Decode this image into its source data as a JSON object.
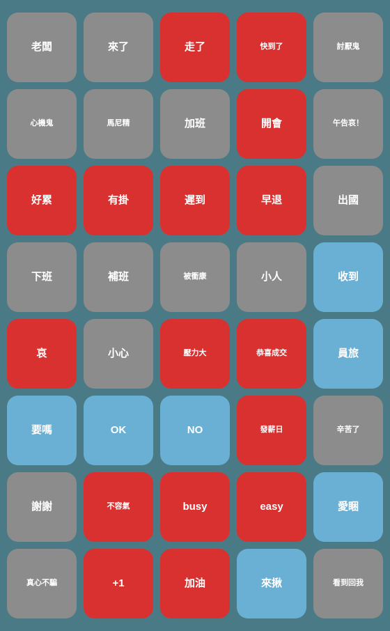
{
  "badges": [
    {
      "label": "老闆",
      "style": "gray",
      "size": "normal"
    },
    {
      "label": "來了",
      "style": "gray",
      "size": "normal"
    },
    {
      "label": "走了",
      "style": "red",
      "size": "normal"
    },
    {
      "label": "快到了",
      "style": "red",
      "size": "small"
    },
    {
      "label": "討厭鬼",
      "style": "gray",
      "size": "small"
    },
    {
      "label": "心機鬼",
      "style": "gray",
      "size": "small"
    },
    {
      "label": "馬尼精",
      "style": "gray",
      "size": "small"
    },
    {
      "label": "加班",
      "style": "gray",
      "size": "normal"
    },
    {
      "label": "開會",
      "style": "red",
      "size": "normal"
    },
    {
      "label": "午告哀！",
      "style": "gray",
      "size": "small"
    },
    {
      "label": "好累",
      "style": "red",
      "size": "normal"
    },
    {
      "label": "有掛",
      "style": "red",
      "size": "normal"
    },
    {
      "label": "遲到",
      "style": "red",
      "size": "normal"
    },
    {
      "label": "早退",
      "style": "red",
      "size": "normal"
    },
    {
      "label": "出國",
      "style": "gray",
      "size": "normal"
    },
    {
      "label": "下班",
      "style": "gray",
      "size": "normal"
    },
    {
      "label": "補班",
      "style": "gray",
      "size": "normal"
    },
    {
      "label": "被衝康",
      "style": "gray",
      "size": "small"
    },
    {
      "label": "小人",
      "style": "gray",
      "size": "normal"
    },
    {
      "label": "收到",
      "style": "blue",
      "size": "normal"
    },
    {
      "label": "哀",
      "style": "red",
      "size": "large"
    },
    {
      "label": "小心",
      "style": "gray",
      "size": "normal"
    },
    {
      "label": "壓力大",
      "style": "red",
      "size": "small"
    },
    {
      "label": "恭喜成交",
      "style": "red",
      "size": "small"
    },
    {
      "label": "員旅",
      "style": "blue",
      "size": "normal"
    },
    {
      "label": "要嗎",
      "style": "blue",
      "size": "normal"
    },
    {
      "label": "OK",
      "style": "blue",
      "size": "normal"
    },
    {
      "label": "NO",
      "style": "blue",
      "size": "normal"
    },
    {
      "label": "發薪日",
      "style": "red",
      "size": "small"
    },
    {
      "label": "辛苦了",
      "style": "gray",
      "size": "small"
    },
    {
      "label": "謝謝",
      "style": "gray",
      "size": "normal"
    },
    {
      "label": "不容氣",
      "style": "red",
      "size": "small"
    },
    {
      "label": "busy",
      "style": "red",
      "size": "normal"
    },
    {
      "label": "easy",
      "style": "red",
      "size": "normal"
    },
    {
      "label": "愛睏",
      "style": "blue",
      "size": "normal"
    },
    {
      "label": "真心不騙",
      "style": "gray",
      "size": "small"
    },
    {
      "label": "+1",
      "style": "red",
      "size": "normal"
    },
    {
      "label": "加油",
      "style": "red",
      "size": "normal"
    },
    {
      "label": "來揪",
      "style": "blue",
      "size": "normal"
    },
    {
      "label": "看到回我",
      "style": "gray",
      "size": "small"
    }
  ]
}
